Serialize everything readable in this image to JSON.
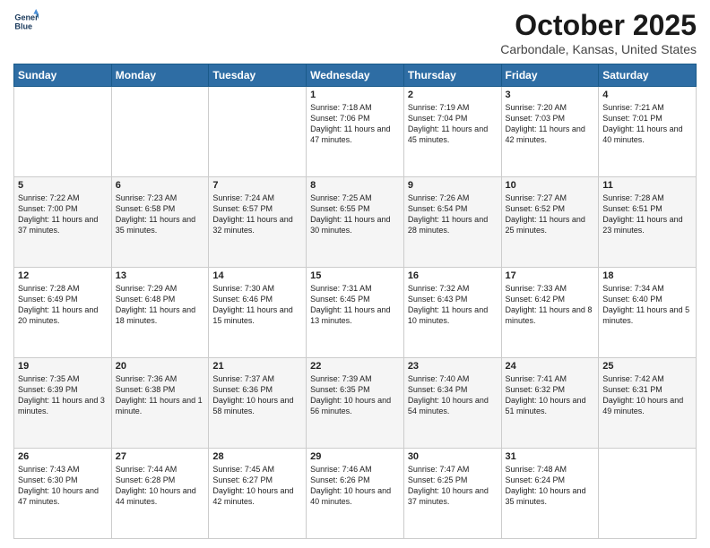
{
  "header": {
    "logo_line1": "General",
    "logo_line2": "Blue",
    "month": "October 2025",
    "location": "Carbondale, Kansas, United States"
  },
  "days_of_week": [
    "Sunday",
    "Monday",
    "Tuesday",
    "Wednesday",
    "Thursday",
    "Friday",
    "Saturday"
  ],
  "weeks": [
    [
      {
        "day": "",
        "sunrise": "",
        "sunset": "",
        "daylight": ""
      },
      {
        "day": "",
        "sunrise": "",
        "sunset": "",
        "daylight": ""
      },
      {
        "day": "",
        "sunrise": "",
        "sunset": "",
        "daylight": ""
      },
      {
        "day": "1",
        "sunrise": "Sunrise: 7:18 AM",
        "sunset": "Sunset: 7:06 PM",
        "daylight": "Daylight: 11 hours and 47 minutes."
      },
      {
        "day": "2",
        "sunrise": "Sunrise: 7:19 AM",
        "sunset": "Sunset: 7:04 PM",
        "daylight": "Daylight: 11 hours and 45 minutes."
      },
      {
        "day": "3",
        "sunrise": "Sunrise: 7:20 AM",
        "sunset": "Sunset: 7:03 PM",
        "daylight": "Daylight: 11 hours and 42 minutes."
      },
      {
        "day": "4",
        "sunrise": "Sunrise: 7:21 AM",
        "sunset": "Sunset: 7:01 PM",
        "daylight": "Daylight: 11 hours and 40 minutes."
      }
    ],
    [
      {
        "day": "5",
        "sunrise": "Sunrise: 7:22 AM",
        "sunset": "Sunset: 7:00 PM",
        "daylight": "Daylight: 11 hours and 37 minutes."
      },
      {
        "day": "6",
        "sunrise": "Sunrise: 7:23 AM",
        "sunset": "Sunset: 6:58 PM",
        "daylight": "Daylight: 11 hours and 35 minutes."
      },
      {
        "day": "7",
        "sunrise": "Sunrise: 7:24 AM",
        "sunset": "Sunset: 6:57 PM",
        "daylight": "Daylight: 11 hours and 32 minutes."
      },
      {
        "day": "8",
        "sunrise": "Sunrise: 7:25 AM",
        "sunset": "Sunset: 6:55 PM",
        "daylight": "Daylight: 11 hours and 30 minutes."
      },
      {
        "day": "9",
        "sunrise": "Sunrise: 7:26 AM",
        "sunset": "Sunset: 6:54 PM",
        "daylight": "Daylight: 11 hours and 28 minutes."
      },
      {
        "day": "10",
        "sunrise": "Sunrise: 7:27 AM",
        "sunset": "Sunset: 6:52 PM",
        "daylight": "Daylight: 11 hours and 25 minutes."
      },
      {
        "day": "11",
        "sunrise": "Sunrise: 7:28 AM",
        "sunset": "Sunset: 6:51 PM",
        "daylight": "Daylight: 11 hours and 23 minutes."
      }
    ],
    [
      {
        "day": "12",
        "sunrise": "Sunrise: 7:28 AM",
        "sunset": "Sunset: 6:49 PM",
        "daylight": "Daylight: 11 hours and 20 minutes."
      },
      {
        "day": "13",
        "sunrise": "Sunrise: 7:29 AM",
        "sunset": "Sunset: 6:48 PM",
        "daylight": "Daylight: 11 hours and 18 minutes."
      },
      {
        "day": "14",
        "sunrise": "Sunrise: 7:30 AM",
        "sunset": "Sunset: 6:46 PM",
        "daylight": "Daylight: 11 hours and 15 minutes."
      },
      {
        "day": "15",
        "sunrise": "Sunrise: 7:31 AM",
        "sunset": "Sunset: 6:45 PM",
        "daylight": "Daylight: 11 hours and 13 minutes."
      },
      {
        "day": "16",
        "sunrise": "Sunrise: 7:32 AM",
        "sunset": "Sunset: 6:43 PM",
        "daylight": "Daylight: 11 hours and 10 minutes."
      },
      {
        "day": "17",
        "sunrise": "Sunrise: 7:33 AM",
        "sunset": "Sunset: 6:42 PM",
        "daylight": "Daylight: 11 hours and 8 minutes."
      },
      {
        "day": "18",
        "sunrise": "Sunrise: 7:34 AM",
        "sunset": "Sunset: 6:40 PM",
        "daylight": "Daylight: 11 hours and 5 minutes."
      }
    ],
    [
      {
        "day": "19",
        "sunrise": "Sunrise: 7:35 AM",
        "sunset": "Sunset: 6:39 PM",
        "daylight": "Daylight: 11 hours and 3 minutes."
      },
      {
        "day": "20",
        "sunrise": "Sunrise: 7:36 AM",
        "sunset": "Sunset: 6:38 PM",
        "daylight": "Daylight: 11 hours and 1 minute."
      },
      {
        "day": "21",
        "sunrise": "Sunrise: 7:37 AM",
        "sunset": "Sunset: 6:36 PM",
        "daylight": "Daylight: 10 hours and 58 minutes."
      },
      {
        "day": "22",
        "sunrise": "Sunrise: 7:39 AM",
        "sunset": "Sunset: 6:35 PM",
        "daylight": "Daylight: 10 hours and 56 minutes."
      },
      {
        "day": "23",
        "sunrise": "Sunrise: 7:40 AM",
        "sunset": "Sunset: 6:34 PM",
        "daylight": "Daylight: 10 hours and 54 minutes."
      },
      {
        "day": "24",
        "sunrise": "Sunrise: 7:41 AM",
        "sunset": "Sunset: 6:32 PM",
        "daylight": "Daylight: 10 hours and 51 minutes."
      },
      {
        "day": "25",
        "sunrise": "Sunrise: 7:42 AM",
        "sunset": "Sunset: 6:31 PM",
        "daylight": "Daylight: 10 hours and 49 minutes."
      }
    ],
    [
      {
        "day": "26",
        "sunrise": "Sunrise: 7:43 AM",
        "sunset": "Sunset: 6:30 PM",
        "daylight": "Daylight: 10 hours and 47 minutes."
      },
      {
        "day": "27",
        "sunrise": "Sunrise: 7:44 AM",
        "sunset": "Sunset: 6:28 PM",
        "daylight": "Daylight: 10 hours and 44 minutes."
      },
      {
        "day": "28",
        "sunrise": "Sunrise: 7:45 AM",
        "sunset": "Sunset: 6:27 PM",
        "daylight": "Daylight: 10 hours and 42 minutes."
      },
      {
        "day": "29",
        "sunrise": "Sunrise: 7:46 AM",
        "sunset": "Sunset: 6:26 PM",
        "daylight": "Daylight: 10 hours and 40 minutes."
      },
      {
        "day": "30",
        "sunrise": "Sunrise: 7:47 AM",
        "sunset": "Sunset: 6:25 PM",
        "daylight": "Daylight: 10 hours and 37 minutes."
      },
      {
        "day": "31",
        "sunrise": "Sunrise: 7:48 AM",
        "sunset": "Sunset: 6:24 PM",
        "daylight": "Daylight: 10 hours and 35 minutes."
      },
      {
        "day": "",
        "sunrise": "",
        "sunset": "",
        "daylight": ""
      }
    ]
  ]
}
